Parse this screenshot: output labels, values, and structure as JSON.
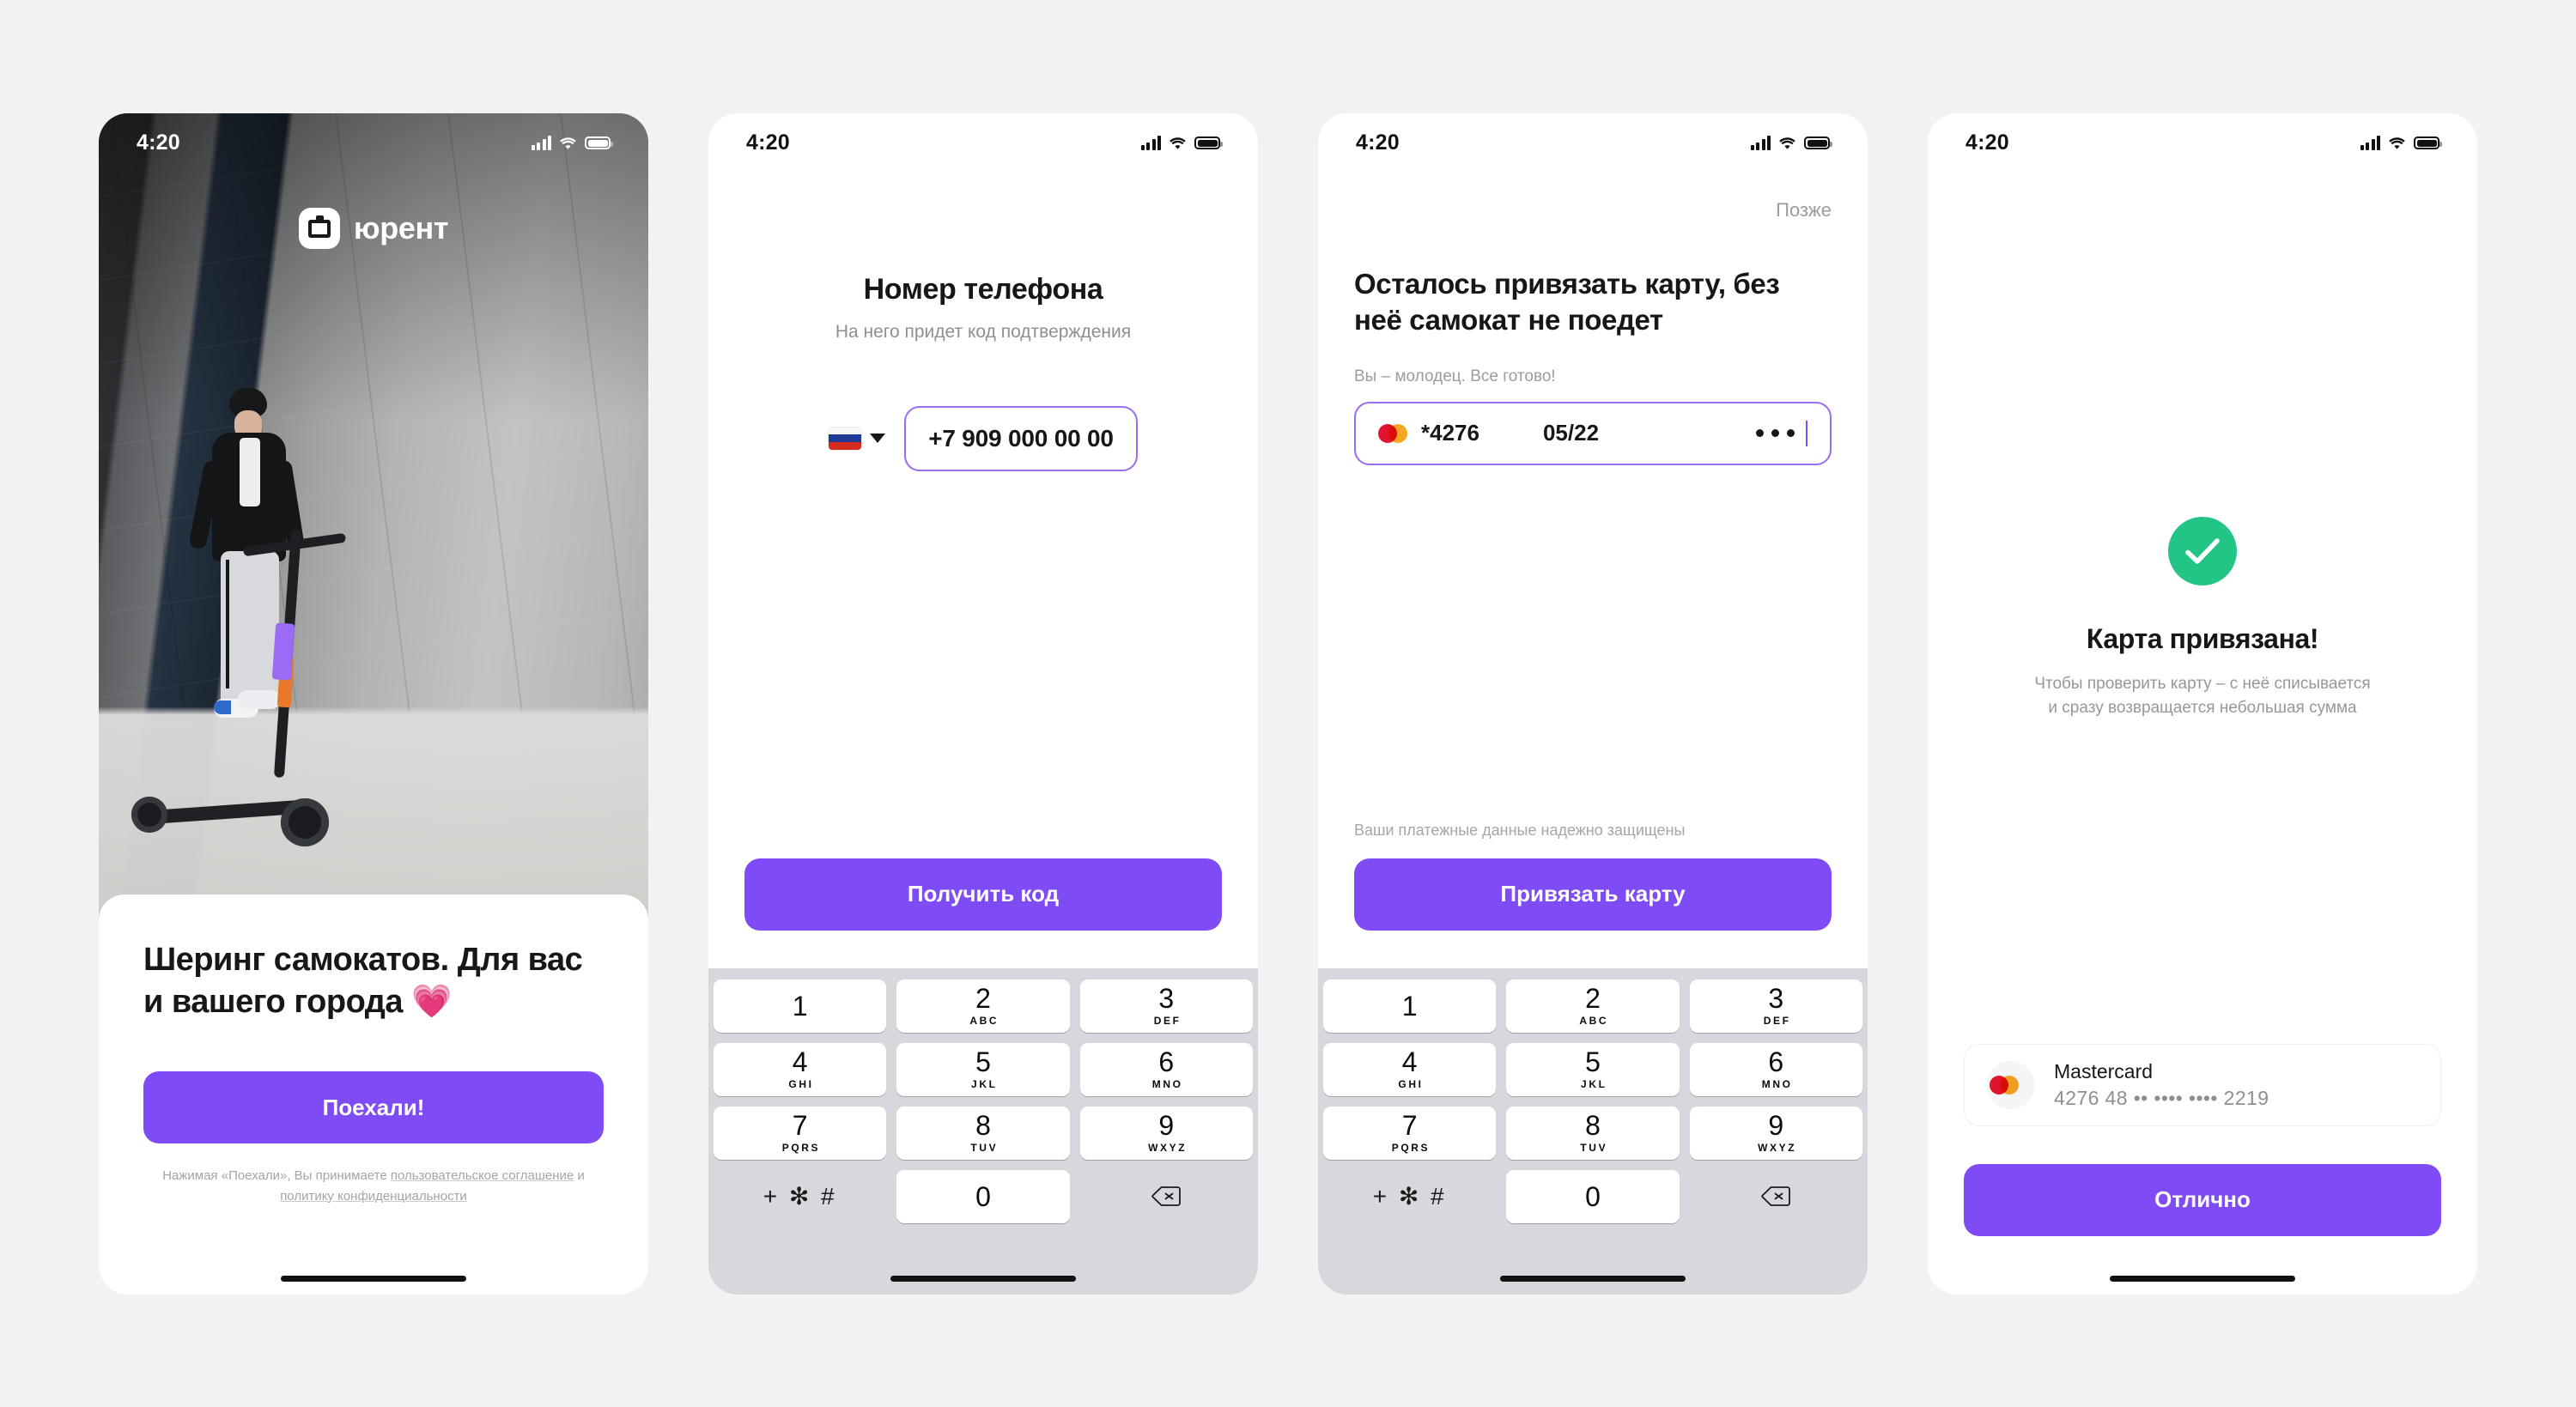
{
  "theme": {
    "accent": "#7f4bf5",
    "accent_border": "#9a6cf3",
    "success": "#22c586",
    "page_bg": "#f2f2f2",
    "keypad_bg": "#d7d8dd",
    "heart": "#f0309a"
  },
  "status_bar": {
    "time": "4:20"
  },
  "screen1": {
    "brand_name": "юрент",
    "headline": "Шеринг самокатов. Для вас и вашего города",
    "heart": "💗",
    "cta": "Поехали!",
    "legal_prefix": "Нажимая «Поехали», Вы принимаете ",
    "legal_link1": "пользовательское соглашение",
    "legal_mid": " и ",
    "legal_link2": "политику конфиденциальности"
  },
  "screen2": {
    "title": "Номер телефона",
    "subtitle": "На него придет код подтверждения",
    "country_flag": "russia-flag",
    "phone_value": "+7 909 000 00 00",
    "cta": "Получить код"
  },
  "screen3": {
    "later": "Позже",
    "title": "Осталось привязать карту, без неё самокат не поедет",
    "hint": "Вы – молодец. Все готово!",
    "card_brand_icon": "mastercard-icon",
    "card_number": "*4276",
    "card_expiry": "05/22",
    "card_cvc_mask": "•••",
    "secure_note": "Ваши платежные данные надежно защищены",
    "cta": "Привязать карту"
  },
  "screen4": {
    "check_icon": "check-icon",
    "title": "Карта привязана!",
    "subtitle_line1": "Чтобы проверить карту – с неё списывается",
    "subtitle_line2": "и сразу возвращается небольшая сумма",
    "card_brand": "Mastercard",
    "card_masked": "4276 48 •• •••• •••• 2219",
    "cta": "Отлично"
  },
  "keypad": {
    "keys": [
      {
        "num": "1",
        "sub": ""
      },
      {
        "num": "2",
        "sub": "ABC"
      },
      {
        "num": "3",
        "sub": "DEF"
      },
      {
        "num": "4",
        "sub": "GHI"
      },
      {
        "num": "5",
        "sub": "JKL"
      },
      {
        "num": "6",
        "sub": "MNO"
      },
      {
        "num": "7",
        "sub": "PQRS"
      },
      {
        "num": "8",
        "sub": "TUV"
      },
      {
        "num": "9",
        "sub": "WXYZ"
      },
      {
        "num": "0",
        "sub": ""
      }
    ],
    "symbols_key": "+ ✻ #",
    "backspace_icon": "backspace-icon"
  }
}
